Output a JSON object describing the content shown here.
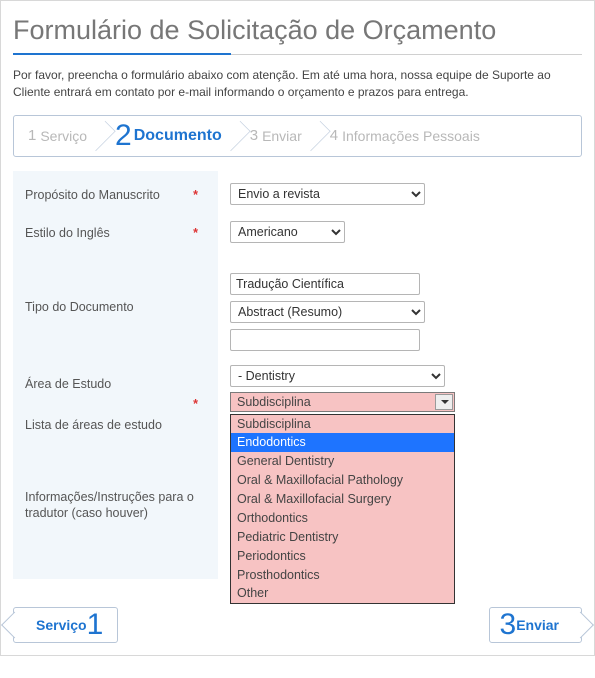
{
  "title": "Formulário de Solicitação de Orçamento",
  "intro": "Por favor, preencha o formulário abaixo com atenção. Em até uma hora, nossa equipe de Suporte ao Cliente entrará em contato por e-mail informando o orçamento e prazos para entrega.",
  "steps": [
    {
      "num": "1",
      "label": "Serviço"
    },
    {
      "num": "2",
      "label": "Documento",
      "active": true
    },
    {
      "num": "3",
      "label": "Enviar"
    },
    {
      "num": "4",
      "label": "Informações Pessoais"
    }
  ],
  "fields": {
    "manuscript_purpose": {
      "label": "Propósito do Manuscrito",
      "required": true,
      "value": "Envio a revista"
    },
    "english_style": {
      "label": "Estilo do Inglês",
      "required": true,
      "value": "Americano"
    },
    "doc_type": {
      "label": "Tipo do Documento",
      "text_input": "Tradução Científica",
      "select_value": "Abstract (Resumo)",
      "extra_input": ""
    },
    "study_area": {
      "label": "Área de Estudo",
      "top_select_value": "- Dentistry",
      "sub_selected_display": "Subdisciplina",
      "options": [
        "Subdisciplina",
        "Endodontics",
        "General Dentistry",
        "Oral & Maxillofacial Pathology",
        "Oral & Maxillofacial Surgery",
        "Orthodontics",
        "Pediatric Dentistry",
        "Periodontics",
        "Prosthodontics",
        "Other"
      ],
      "highlighted_index": 1,
      "list_label": "Lista de áreas de estudo",
      "required": true
    },
    "translator_notes": {
      "label": "Informações/Instruções para o tradutor (caso houver)",
      "value": ""
    }
  },
  "footer": {
    "prev": {
      "num": "1",
      "label": "Serviço"
    },
    "next": {
      "num": "3",
      "label": "Enviar"
    }
  }
}
